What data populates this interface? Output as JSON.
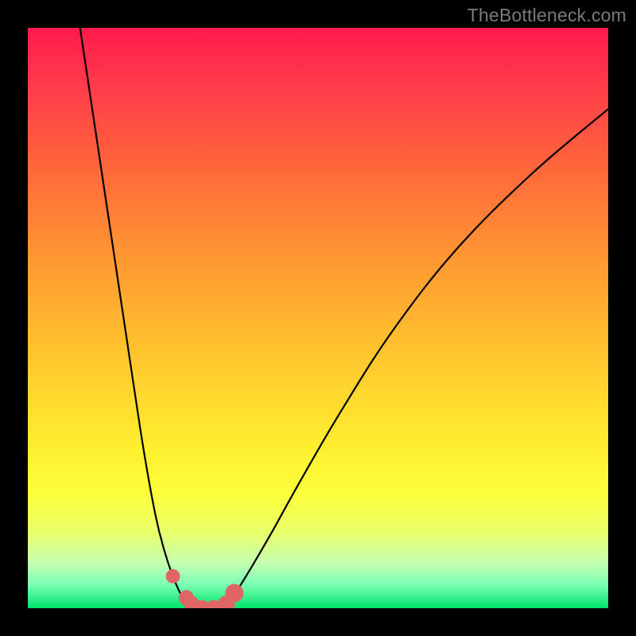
{
  "watermark": "TheBottleneck.com",
  "chart_data": {
    "type": "line",
    "title": "",
    "xlabel": "",
    "ylabel": "",
    "xlim": [
      0,
      100
    ],
    "ylim": [
      0,
      100
    ],
    "grid": false,
    "legend": false,
    "series": [
      {
        "name": "left-curve",
        "x": [
          9,
          12,
          15,
          18,
          20,
          22,
          23.5,
          25,
          26.5,
          28
        ],
        "y": [
          100,
          80,
          60,
          40,
          27,
          16,
          10,
          5.5,
          2.2,
          0.6
        ]
      },
      {
        "name": "right-curve",
        "x": [
          34,
          36,
          38.5,
          42,
          47,
          54,
          63,
          74,
          87,
          100
        ],
        "y": [
          0.6,
          3,
          7,
          13,
          22,
          34,
          48,
          62,
          75,
          86
        ]
      }
    ],
    "floor": {
      "name": "valley-floor",
      "x": [
        28,
        30,
        32,
        34
      ],
      "y": [
        0.6,
        0.0,
        0.0,
        0.6
      ]
    },
    "markers": [
      {
        "x": 25.0,
        "y": 5.5,
        "r": 0.9
      },
      {
        "x": 27.3,
        "y": 1.8,
        "r": 1.0
      },
      {
        "x": 28.2,
        "y": 0.8,
        "r": 1.0
      },
      {
        "x": 30.0,
        "y": 0.0,
        "r": 1.1
      },
      {
        "x": 32.0,
        "y": 0.0,
        "r": 1.1
      },
      {
        "x": 34.2,
        "y": 0.7,
        "r": 1.2
      },
      {
        "x": 35.6,
        "y": 2.6,
        "r": 1.3
      }
    ],
    "background_gradient": {
      "top": "#ff1a4d",
      "mid": "#ffe92e",
      "bottom": "#00e46a"
    }
  }
}
